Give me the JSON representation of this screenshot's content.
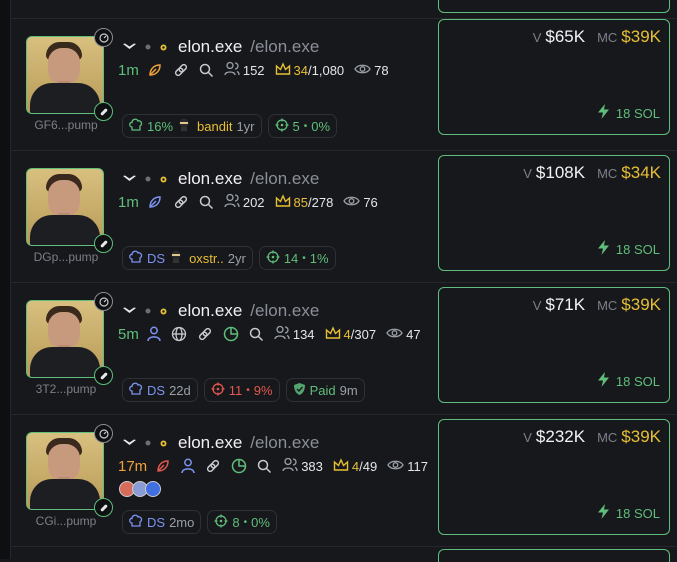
{
  "colors": {
    "green": "#5fbe7b",
    "gold": "#e6bf35",
    "red": "#e2584f",
    "blue": "#7b93f0",
    "orange": "#f0a13a"
  },
  "tokens": [
    {
      "name": "elon.exe",
      "handle": "/elon.exe",
      "address": "GF6...pump",
      "age": "1m",
      "holders": "152",
      "top_a": "34",
      "top_b": "/1,080",
      "views": "78",
      "pills": {
        "p1_value": "16%",
        "p1_user": "bandit",
        "p1_age": "1yr",
        "p2_a": "5",
        "p2_b": "0%"
      },
      "volume_label": "V",
      "volume": "$65K",
      "mc_label": "MC",
      "mc": "$39K",
      "sol": "18 SOL"
    },
    {
      "name": "elon.exe",
      "handle": "/elon.exe",
      "address": "DGp...pump",
      "age": "1m",
      "holders": "202",
      "top_a": "85",
      "top_b": "/278",
      "views": "76",
      "pills": {
        "p1_label": "DS",
        "p1_user": "oxstr..",
        "p1_age": "2yr",
        "p2_a": "14",
        "p2_b": "1%"
      },
      "volume_label": "V",
      "volume": "$108K",
      "mc_label": "MC",
      "mc": "$34K",
      "sol": "18 SOL"
    },
    {
      "name": "elon.exe",
      "handle": "/elon.exe",
      "address": "3T2...pump",
      "age": "5m",
      "holders": "134",
      "top_a": "4",
      "top_b": "/307",
      "views": "47",
      "pills": {
        "p1_label": "DS",
        "p1_age": "22d",
        "p2_a": "11",
        "p2_b": "9%",
        "p3_label": "Paid",
        "p3_age": "9m"
      },
      "volume_label": "V",
      "volume": "$71K",
      "mc_label": "MC",
      "mc": "$39K",
      "sol": "18 SOL"
    },
    {
      "name": "elon.exe",
      "handle": "/elon.exe",
      "address": "CGi...pump",
      "age": "17m",
      "holders": "383",
      "top_a": "4",
      "top_b": "/49",
      "views": "117",
      "pills": {
        "p1_label": "DS",
        "p1_age": "2mo",
        "p2_a": "8",
        "p2_b": "0%"
      },
      "volume_label": "V",
      "volume": "$232K",
      "mc_label": "MC",
      "mc": "$39K",
      "sol": "18 SOL"
    }
  ],
  "separator": "•",
  "icons": [
    "bird-icon",
    "dot-icon",
    "pill-icon",
    "leaf-icon",
    "link-icon",
    "search-icon",
    "users-icon",
    "crown-icon",
    "eye-icon",
    "chef-hat-icon",
    "crosshair-icon",
    "bolt-icon",
    "globe-icon",
    "person-icon",
    "pie-chart-icon",
    "ninja-icon",
    "shield-icon"
  ]
}
